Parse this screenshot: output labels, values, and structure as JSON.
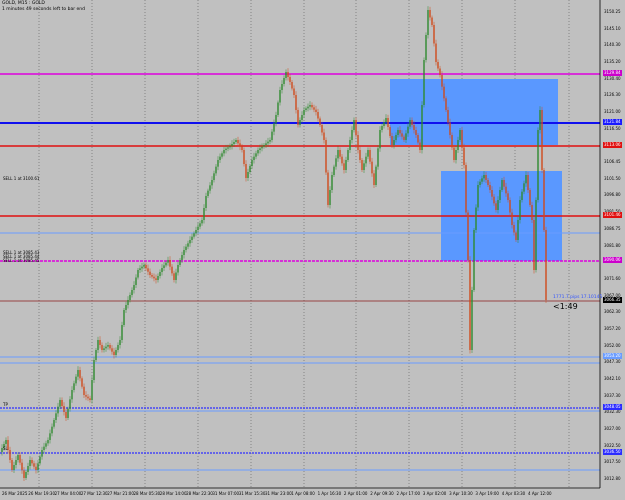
{
  "header": {
    "symbol": "GOLD, M15 : GOLD",
    "timer": "1 minutes 49 seconds left to bar end"
  },
  "price_scale": [
    "3150.25",
    "3145.10",
    "3140.30",
    "3135.20",
    "3130.40",
    "3126.30",
    "3121.00",
    "3116.50",
    "3111.30",
    "3106.45",
    "3101.50",
    "3096.80",
    "3091.50",
    "3086.75",
    "3081.80",
    "3076.85",
    "3071.60",
    "3067.00",
    "3062.30",
    "3057.20",
    "3052.00",
    "3047.30",
    "3042.10",
    "3037.30",
    "3032.30",
    "3027.00",
    "3022.50",
    "3017.50",
    "3012.80"
  ],
  "price_tags": [
    {
      "text": "3129.84",
      "color": "#cc00cc"
    },
    {
      "text": "3121.84",
      "color": "#1a1aff"
    },
    {
      "text": "3113.06",
      "color": "#e01010"
    },
    {
      "text": "3101.46",
      "color": "#e01010"
    },
    {
      "text": "3090.06",
      "color": "#cc00cc"
    },
    {
      "text": "3066.35",
      "color": "#000000"
    },
    {
      "text": "3053.20",
      "color": "#6a9cff"
    },
    {
      "text": "3048.05",
      "color": "#2c2cff"
    },
    {
      "text": "3036.50",
      "color": "#2c2cff"
    }
  ],
  "time_axis": [
    "26 Mar 2025",
    "26 Mar 19:30",
    "27 Mar 04:00",
    "27 Mar 12:30",
    "27 Mar 21:00",
    "28 Mar 05:30",
    "28 Mar 14:00",
    "28 Mar 22:30",
    "31 Mar 07:00",
    "31 Mar 15:30",
    "31 Mar 23:00",
    "1 Apr 08:00",
    "1 Apr 16:30",
    "2 Apr 01:00",
    "2 Apr 09:30",
    "2 Apr 17:00",
    "3 Apr 02:00",
    "3 Apr 10:30",
    "3 Apr 19:00",
    "4 Apr 03:30",
    "4 Apr 12:00"
  ],
  "line_labels": {
    "sell_limit": "SELL 1 at 3100.61",
    "stacked_1": "SELL 1 at 3085.43",
    "stacked_2": "SELL 1 at 3085.44",
    "stacked_3": "SELL 1 at 3085.45",
    "tp": "TP",
    "sl": "SL"
  },
  "fib_text": "1771.7 pips 17.10145",
  "countdown": "<1:49",
  "colors": {
    "background": "#c0c0c0",
    "grid": "#4a4a4a",
    "candle_up": "#2e8b2e",
    "candle_down": "#d04a1a",
    "zone": "#5a98ff"
  }
}
